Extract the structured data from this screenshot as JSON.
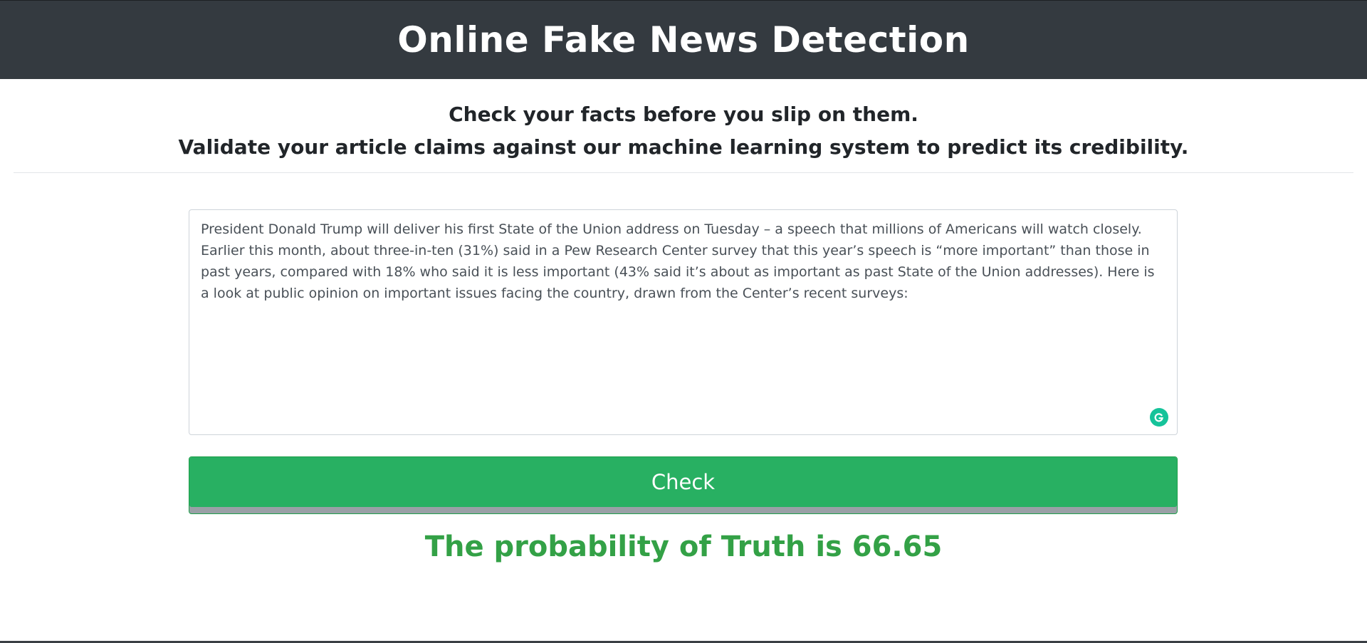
{
  "header": {
    "title": "Online Fake News Detection"
  },
  "tagline": {
    "line1": "Check your facts before you slip on them.",
    "line2": "Validate your article claims against our machine learning system to predict its credibility."
  },
  "article": {
    "value": "President Donald Trump will deliver his first State of the Union address on Tuesday – a speech that millions of Americans will watch closely. Earlier this month, about three-in-ten (31%) said in a Pew Research Center survey that this year’s speech is “more important” than those in past years, compared with 18% who said it is less important (43% said it’s about as important as past State of the Union addresses). Here is a look at public opinion on important issues facing the country, drawn from the Center’s recent surveys:"
  },
  "check_button": {
    "label": "Check"
  },
  "result": {
    "text": "The probability of Truth is 66.65"
  },
  "colors": {
    "header_bg": "#343a40",
    "button_bg": "#28b062",
    "result_text": "#33a146",
    "grammarly": "#15c39a"
  },
  "icons": {
    "grammarly": "grammarly-icon"
  }
}
